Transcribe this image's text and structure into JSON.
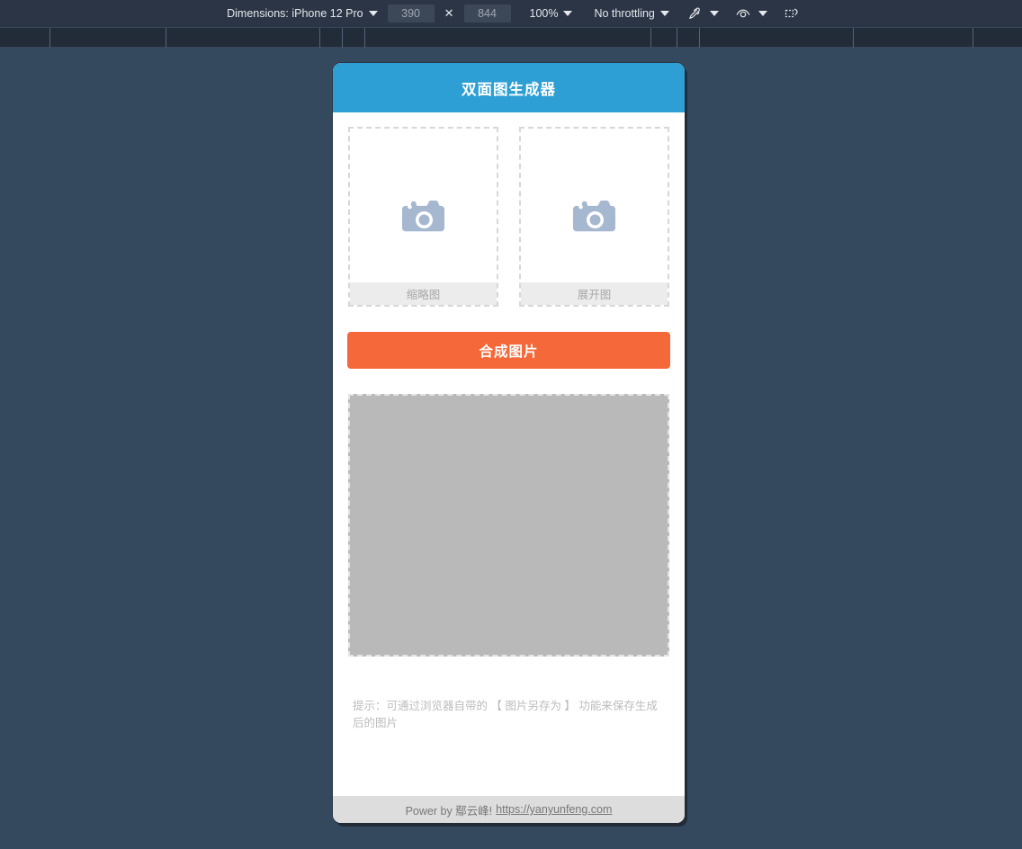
{
  "devtools_toolbar": {
    "dimensions_label": "Dimensions: iPhone 12 Pro",
    "width_value": "390",
    "multiply_symbol": "✕",
    "height_value": "844",
    "zoom_value": "100%",
    "throttling_value": "No throttling",
    "icons": {
      "dimensions_caret": "chevron-down-icon",
      "zoom_caret": "chevron-down-icon",
      "throttling_caret": "chevron-down-icon",
      "eyedropper": "eyedropper-icon",
      "eyedropper_caret": "chevron-down-icon",
      "vision_deficiency": "eye-icon",
      "vision_caret": "chevron-down-icon",
      "rotate_device": "rotate-device-icon"
    }
  },
  "ruler": {
    "tick_positions": [
      55,
      184,
      355,
      380,
      405,
      723,
      752,
      777,
      948,
      1081
    ]
  },
  "app": {
    "title": "双面图生成器",
    "uploads": [
      {
        "label": "缩略图",
        "icon": "camera-icon"
      },
      {
        "label": "展开图",
        "icon": "camera-icon"
      }
    ],
    "compose_button": "合成图片",
    "result_canvas": {
      "state": "empty"
    },
    "hint": "提示：可通过浏览器自带的 【 图片另存为 】 功能来保存生成后的图片",
    "footer": {
      "prefix": "Power by 鄢云峰!",
      "link_text": "https://yanyunfeng.com"
    }
  },
  "colors": {
    "devtools_bg": "#2b3545",
    "page_bg": "#34495e",
    "header_blue": "#2d9fd4",
    "accent_orange": "#f4683a",
    "canvas_gray": "#b9b9b9",
    "camera_icon": "#a6b8d0"
  }
}
